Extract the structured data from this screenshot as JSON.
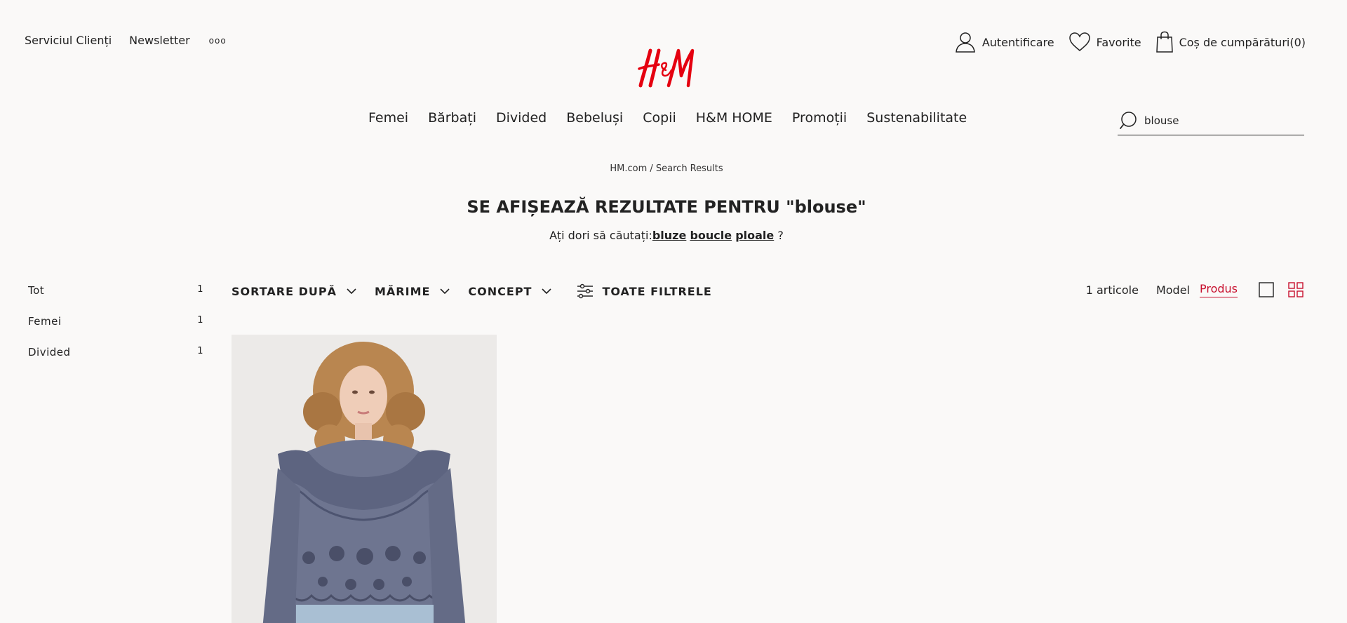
{
  "header": {
    "customer_service": "Serviciul Clienți",
    "newsletter": "Newsletter",
    "more": "ooo",
    "brand": "H&M",
    "login": "Autentificare",
    "favorites": "Favorite",
    "cart": "Coș de cumpărături(0)"
  },
  "nav": [
    "Femei",
    "Bărbați",
    "Divided",
    "Bebeluși",
    "Copii",
    "H&M HOME",
    "Promoții",
    "Sustenabilitate"
  ],
  "search": {
    "value": "blouse"
  },
  "breadcrumb": "HM.com / Search Results",
  "title": "SE AFIȘEAZĂ REZULTATE PENTRU \"blouse\"",
  "suggestion": {
    "prefix": "Ați dori să căutați:",
    "links": [
      "bluze",
      "boucle",
      "ploale"
    ],
    "suffix": " ?"
  },
  "sidebar": [
    {
      "label": "Tot",
      "count": "1"
    },
    {
      "label": "Femei",
      "count": "1"
    },
    {
      "label": "Divided",
      "count": "1"
    }
  ],
  "filters": {
    "sort": "SORTARE DUPĂ",
    "size": "MĂRIME",
    "concept": "CONCEPT",
    "all": "TOATE FILTRELE"
  },
  "results": {
    "count": "1 articole",
    "model": "Model",
    "product": "Produs"
  },
  "colors": {
    "background": "#faf9f8",
    "brand_red": "#e50010",
    "accent_red": "#c8102e",
    "text": "#222222"
  }
}
